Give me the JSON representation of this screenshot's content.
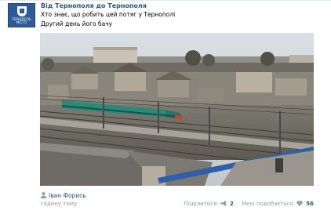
{
  "post": {
    "title": "Від Тернополя до Тернополя",
    "text_line1": "Хто знає, що робить цей потяг у Тернополі",
    "text_line2": "Другий день його бачу",
    "author": "Іван Форись",
    "time": "годину тому"
  },
  "avatar": {
    "caption_line1": "ТЕРНОПІЛЬ",
    "caption_line2": "МІСТО"
  },
  "actions": {
    "share_label": "Поділитися",
    "share_count": "2",
    "like_label": "Мені подобається",
    "like_count": "56"
  },
  "colors": {
    "link": "#2b587a",
    "muted": "#999999",
    "avatar_bg": "#2c5b97",
    "train": "#2a8a78"
  },
  "icons": {
    "share": "megaphone-icon",
    "like": "heart-icon",
    "author": "person-icon"
  }
}
